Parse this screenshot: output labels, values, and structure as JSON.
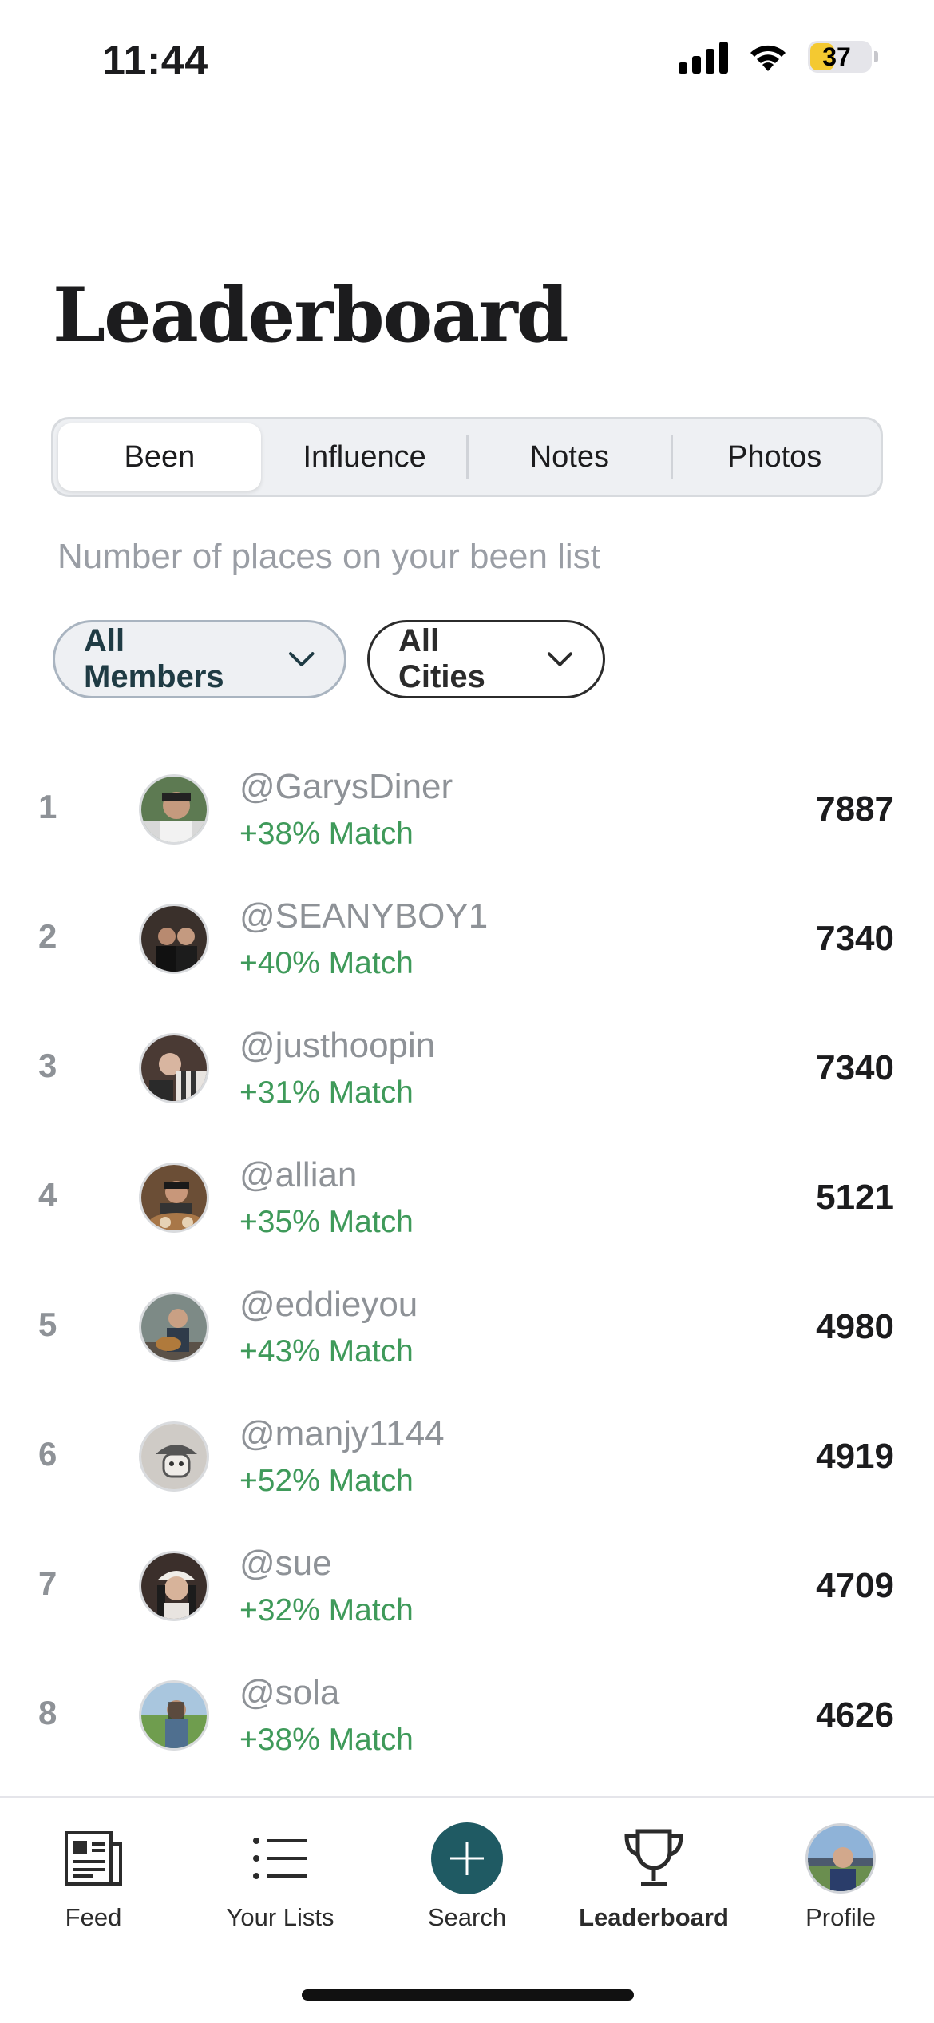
{
  "status": {
    "time": "11:44",
    "battery": "37"
  },
  "page": {
    "title": "Leaderboard",
    "subtitle": "Number of places on your been list"
  },
  "segments": [
    {
      "label": "Been",
      "active": true
    },
    {
      "label": "Influence",
      "active": false
    },
    {
      "label": "Notes",
      "active": false
    },
    {
      "label": "Photos",
      "active": false
    }
  ],
  "filters": {
    "members": "All Members",
    "cities": "All Cities"
  },
  "leaderboard": [
    {
      "rank": "1",
      "username": "@GarysDiner",
      "match": "+38% Match",
      "count": "7887"
    },
    {
      "rank": "2",
      "username": "@SEANYBOY1",
      "match": "+40% Match",
      "count": "7340"
    },
    {
      "rank": "3",
      "username": "@justhoopin",
      "match": "+31% Match",
      "count": "7340"
    },
    {
      "rank": "4",
      "username": "@allian",
      "match": "+35% Match",
      "count": "5121"
    },
    {
      "rank": "5",
      "username": "@eddieyou",
      "match": "+43% Match",
      "count": "4980"
    },
    {
      "rank": "6",
      "username": "@manjy1144",
      "match": "+52% Match",
      "count": "4919"
    },
    {
      "rank": "7",
      "username": "@sue",
      "match": "+32% Match",
      "count": "4709"
    },
    {
      "rank": "8",
      "username": "@sola",
      "match": "+38% Match",
      "count": "4626"
    }
  ],
  "tabs": [
    {
      "label": "Feed",
      "icon": "newspaper-icon"
    },
    {
      "label": "Your Lists",
      "icon": "list-icon"
    },
    {
      "label": "Search",
      "icon": "plus-icon"
    },
    {
      "label": "Leaderboard",
      "icon": "trophy-icon",
      "active": true
    },
    {
      "label": "Profile",
      "icon": "profile-avatar"
    }
  ],
  "colors": {
    "accent": "#1f5a63",
    "match_green": "#3f9a5a",
    "battery_yellow": "#f4c931"
  }
}
